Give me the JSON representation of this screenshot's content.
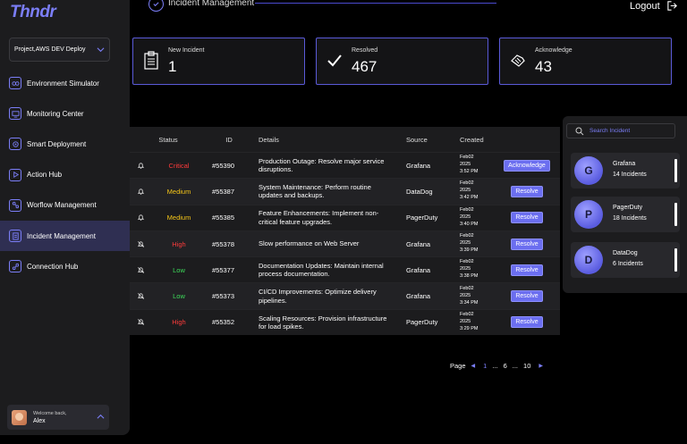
{
  "app": {
    "logo": "Thndr"
  },
  "sidebar": {
    "project": "Project,AWS DEV Deploy",
    "items": [
      {
        "label": "Environment Simulator",
        "icon": "environment-icon"
      },
      {
        "label": "Monitoring Center",
        "icon": "monitor-icon"
      },
      {
        "label": "Smart Deployment",
        "icon": "deploy-icon"
      },
      {
        "label": "Action Hub",
        "icon": "play-icon"
      },
      {
        "label": "Worflow Management",
        "icon": "workflow-icon"
      },
      {
        "label": "Incident Management",
        "icon": "incident-icon",
        "active": true
      },
      {
        "label": "Connection Hub",
        "icon": "connection-icon"
      }
    ],
    "user": {
      "welcome": "Welcome back,",
      "name": "Alex"
    }
  },
  "header": {
    "title": "Incident Management",
    "logout": "Logout"
  },
  "stats": [
    {
      "label": "New Incident",
      "value": "1",
      "icon": "clipboard-icon"
    },
    {
      "label": "Resolved",
      "value": "467",
      "icon": "check-icon"
    },
    {
      "label": "Acknowledge",
      "value": "43",
      "icon": "handshake-icon"
    }
  ],
  "table": {
    "headers": {
      "status": "Status",
      "id": "ID",
      "details": "Details",
      "source": "Source",
      "created": "Created"
    },
    "rows": [
      {
        "icon": "bell-icon",
        "status": "Critical",
        "status_color": "#ff3b3b",
        "id": "#55390",
        "details": "Production Outage: Resolve major service disruptions.",
        "source": "Grafana",
        "created": [
          "Feb02",
          "2025",
          "3:52 PM"
        ],
        "action": "Acknowledge"
      },
      {
        "icon": "bell-icon",
        "status": "Medium",
        "status_color": "#f5c518",
        "id": "#55387",
        "details": "System Maintenance: Perform routine updates and backups.",
        "source": "DataDog",
        "created": [
          "Feb02",
          "2025",
          "3:42 PM"
        ],
        "action": "Resolve"
      },
      {
        "icon": "bell-icon",
        "status": "Medium",
        "status_color": "#f5c518",
        "id": "#55385",
        "details": "Feature Enhancements: Implement non-critical feature upgrades.",
        "source": "PagerDuty",
        "created": [
          "Feb02",
          "2025",
          "3:40 PM"
        ],
        "action": "Resolve"
      },
      {
        "icon": "bell-off-icon",
        "status": "High",
        "status_color": "#ff3b3b",
        "id": "#55378",
        "details": "Slow performance on Web Server",
        "source": "Grafana",
        "created": [
          "Feb02",
          "2025",
          "3:39 PM"
        ],
        "action": "Resolve"
      },
      {
        "icon": "bell-off-icon",
        "status": "Low",
        "status_color": "#3ddc5a",
        "id": "#55377",
        "details": "Documentation Updates: Maintain internal process documentation.",
        "source": "Grafana",
        "created": [
          "Feb02",
          "2025",
          "3:38 PM"
        ],
        "action": "Resolve"
      },
      {
        "icon": "bell-off-icon",
        "status": "Low",
        "status_color": "#3ddc5a",
        "id": "#55373",
        "details": "CI/CD Improvements: Optimize delivery pipelines.",
        "source": "Grafana",
        "created": [
          "Feb02",
          "2025",
          "3:34 PM"
        ],
        "action": "Resolve"
      },
      {
        "icon": "bell-off-icon",
        "status": "High",
        "status_color": "#ff3b3b",
        "id": "#55352",
        "details": "Scaling Resources: Provision infrastructure for load spikes.",
        "source": "PagerDuty",
        "created": [
          "Feb02",
          "2025",
          "3:29 PM"
        ],
        "action": "Resolve"
      }
    ]
  },
  "pagination": {
    "label": "Page",
    "pages": [
      "1",
      "...",
      "6",
      "...",
      "10"
    ],
    "current": "1"
  },
  "right_panel": {
    "search_placeholder": "Search Incident",
    "sources": [
      {
        "name": "Grafana",
        "count": "14 Incidents",
        "glyph": "G"
      },
      {
        "name": "PagerDuty",
        "count": "18 Incidents",
        "glyph": "P"
      },
      {
        "name": "DataDog",
        "count": "6 Incidents",
        "glyph": "D"
      }
    ]
  },
  "colors": {
    "accent": "#7b7ef7",
    "button": "#6b6ef0"
  }
}
